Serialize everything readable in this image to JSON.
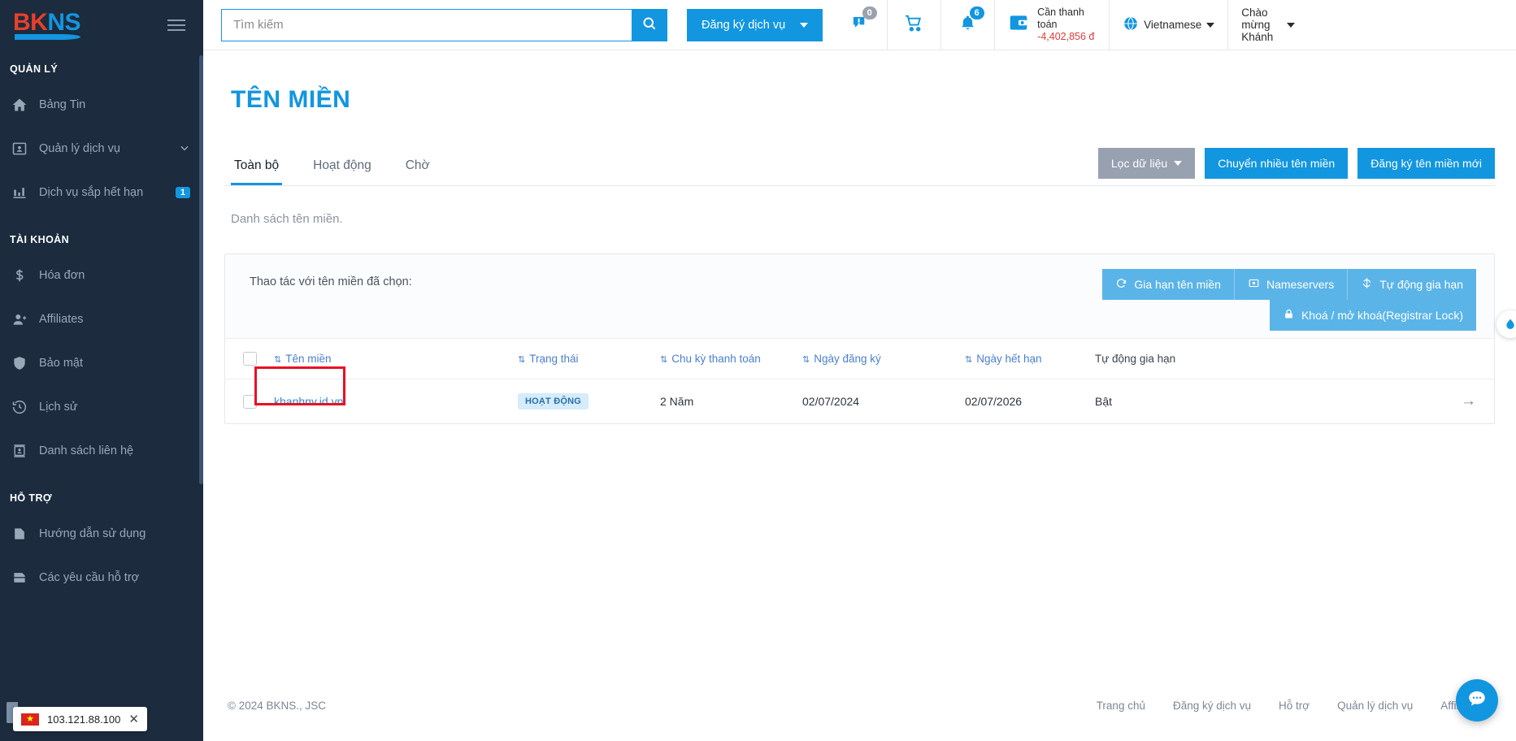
{
  "sidebar": {
    "logo": {
      "part1": "BK",
      "part2": "NS"
    },
    "menu_icon": "hamburger-icon",
    "sections": [
      {
        "title": "QUẢN LÝ",
        "items": [
          {
            "label": "Bảng Tin",
            "icon": "home-icon",
            "badge": null,
            "chevron": false
          },
          {
            "label": "Quản lý dịch vụ",
            "icon": "id-card-icon",
            "badge": null,
            "chevron": true
          },
          {
            "label": "Dịch vụ sắp hết hạn",
            "icon": "bar-chart-icon",
            "badge": "1",
            "chevron": false
          }
        ]
      },
      {
        "title": "TÀI KHOẢN",
        "items": [
          {
            "label": "Hóa đơn",
            "icon": "dollar-icon",
            "badge": null,
            "chevron": false
          },
          {
            "label": "Affiliates",
            "icon": "user-plus-icon",
            "badge": null,
            "chevron": false
          },
          {
            "label": "Bảo mật",
            "icon": "shield-icon",
            "badge": null,
            "chevron": false
          },
          {
            "label": "Lịch sử",
            "icon": "history-icon",
            "badge": null,
            "chevron": false
          },
          {
            "label": "Danh sách liên hệ",
            "icon": "contacts-icon",
            "badge": null,
            "chevron": false
          }
        ]
      },
      {
        "title": "HỖ TRỢ",
        "items": [
          {
            "label": "Hướng dẫn sử dụng",
            "icon": "document-icon",
            "badge": null,
            "chevron": false
          },
          {
            "label": "Các yêu cầu hỗ trợ",
            "icon": "support-icon",
            "badge": null,
            "chevron": false
          }
        ]
      }
    ],
    "ip_badge": {
      "ip": "103.121.88.100",
      "flag": "vietnam-flag-icon",
      "close": "✕"
    }
  },
  "topbar": {
    "search": {
      "placeholder": "Tìm kiếm",
      "value": "",
      "icon": "search-icon"
    },
    "register_service_button": "Đăng ký dịch vụ",
    "chat": {
      "icon": "chat-alert-icon",
      "count": "0"
    },
    "cart": {
      "icon": "shopping-cart-icon"
    },
    "notifications": {
      "icon": "bell-icon",
      "count": "6"
    },
    "payment": {
      "icon": "wallet-icon",
      "label": "Cần thanh toán",
      "amount": "-4,402,856 đ"
    },
    "language": {
      "icon": "globe-icon",
      "value": "Vietnamese"
    },
    "user": {
      "greeting": "Chào mừng",
      "name": "Khánh"
    }
  },
  "main": {
    "page_title": "TÊN MIỀN",
    "tabs": [
      {
        "label": "Toàn bộ",
        "active": true
      },
      {
        "label": "Hoạt động",
        "active": false
      },
      {
        "label": "Chờ",
        "active": false
      }
    ],
    "tab_actions": {
      "filter": "Lọc dữ liệu",
      "transfer_many": "Chuyển nhiều tên miền",
      "register_new": "Đăng ký tên miền mới"
    },
    "list_note": "Danh sách tên miền.",
    "card": {
      "bulk_label": "Thao tác với tên miền đã chọn:",
      "bulk_buttons": [
        {
          "label": "Gia hạn tên miền",
          "icon": "refresh-icon"
        },
        {
          "label": "Nameservers",
          "icon": "server-icon"
        },
        {
          "label": "Tự động gia hạn",
          "icon": "autorenew-icon"
        },
        {
          "label": "Khoá / mở khoá(Registrar Lock)",
          "icon": "lock-icon"
        }
      ],
      "columns": [
        {
          "label": "",
          "sortable": false
        },
        {
          "label": "Tên miền",
          "sortable": true
        },
        {
          "label": "Trạng thái",
          "sortable": true
        },
        {
          "label": "Chu kỳ thanh toán",
          "sortable": true
        },
        {
          "label": "Ngày đăng ký",
          "sortable": true
        },
        {
          "label": "Ngày hết hạn",
          "sortable": true
        },
        {
          "label": "Tự động gia hạn",
          "sortable": false
        },
        {
          "label": "",
          "sortable": false
        }
      ],
      "rows": [
        {
          "domain": "khanhnv.id.vn",
          "status": "HOẠT ĐỘNG",
          "cycle": "2 Năm",
          "registered": "02/07/2024",
          "expires": "02/07/2026",
          "autorenew": "Bật",
          "arrow": "→",
          "highlighted": true
        }
      ]
    }
  },
  "footer": {
    "copyright": "© 2024 BKNS., JSC",
    "links": [
      "Trang chủ",
      "Đăng ký dịch vụ",
      "Hỗ trợ",
      "Quản lý dịch vụ",
      "Affiliates"
    ]
  },
  "fab": {
    "icon": "chat-bubble-icon"
  },
  "colors": {
    "accent": "#1296e0",
    "sidebar_bg": "#1c2b3e",
    "bulk_btn": "#5bb4e8",
    "grey_btn": "#97a1b0",
    "negative": "#e23b3b",
    "highlight_box": "#e81123"
  }
}
